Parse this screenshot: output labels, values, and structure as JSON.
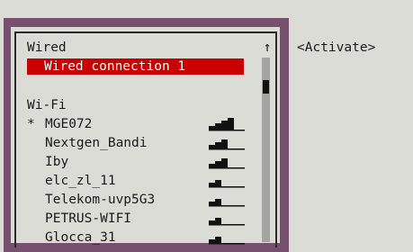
{
  "actions": {
    "activate": "<Activate>"
  },
  "scroll": {
    "up_arrow": "↑"
  },
  "sections": {
    "wired": {
      "title": "Wired",
      "connections": [
        {
          "label": "Wired connection 1",
          "selected": true
        }
      ]
    },
    "wifi": {
      "title": "Wi-Fi",
      "networks": [
        {
          "marker": "*",
          "ssid": "MGE072",
          "signal": 4
        },
        {
          "marker": " ",
          "ssid": "Nextgen_Bandi",
          "signal": 3
        },
        {
          "marker": " ",
          "ssid": "Iby",
          "signal": 3
        },
        {
          "marker": " ",
          "ssid": "elc_zl_11",
          "signal": 2
        },
        {
          "marker": " ",
          "ssid": "Telekom-uvp5G3",
          "signal": 2
        },
        {
          "marker": " ",
          "ssid": "PETRUS-WIFI",
          "signal": 2
        },
        {
          "marker": " ",
          "ssid": "Glocca_31",
          "signal": 2
        }
      ]
    }
  },
  "colors": {
    "background": "#dcdcd6",
    "frame": "#76506e",
    "selection": "#c80000",
    "selection_text": "#ffffff",
    "text": "#1a1a1a"
  }
}
